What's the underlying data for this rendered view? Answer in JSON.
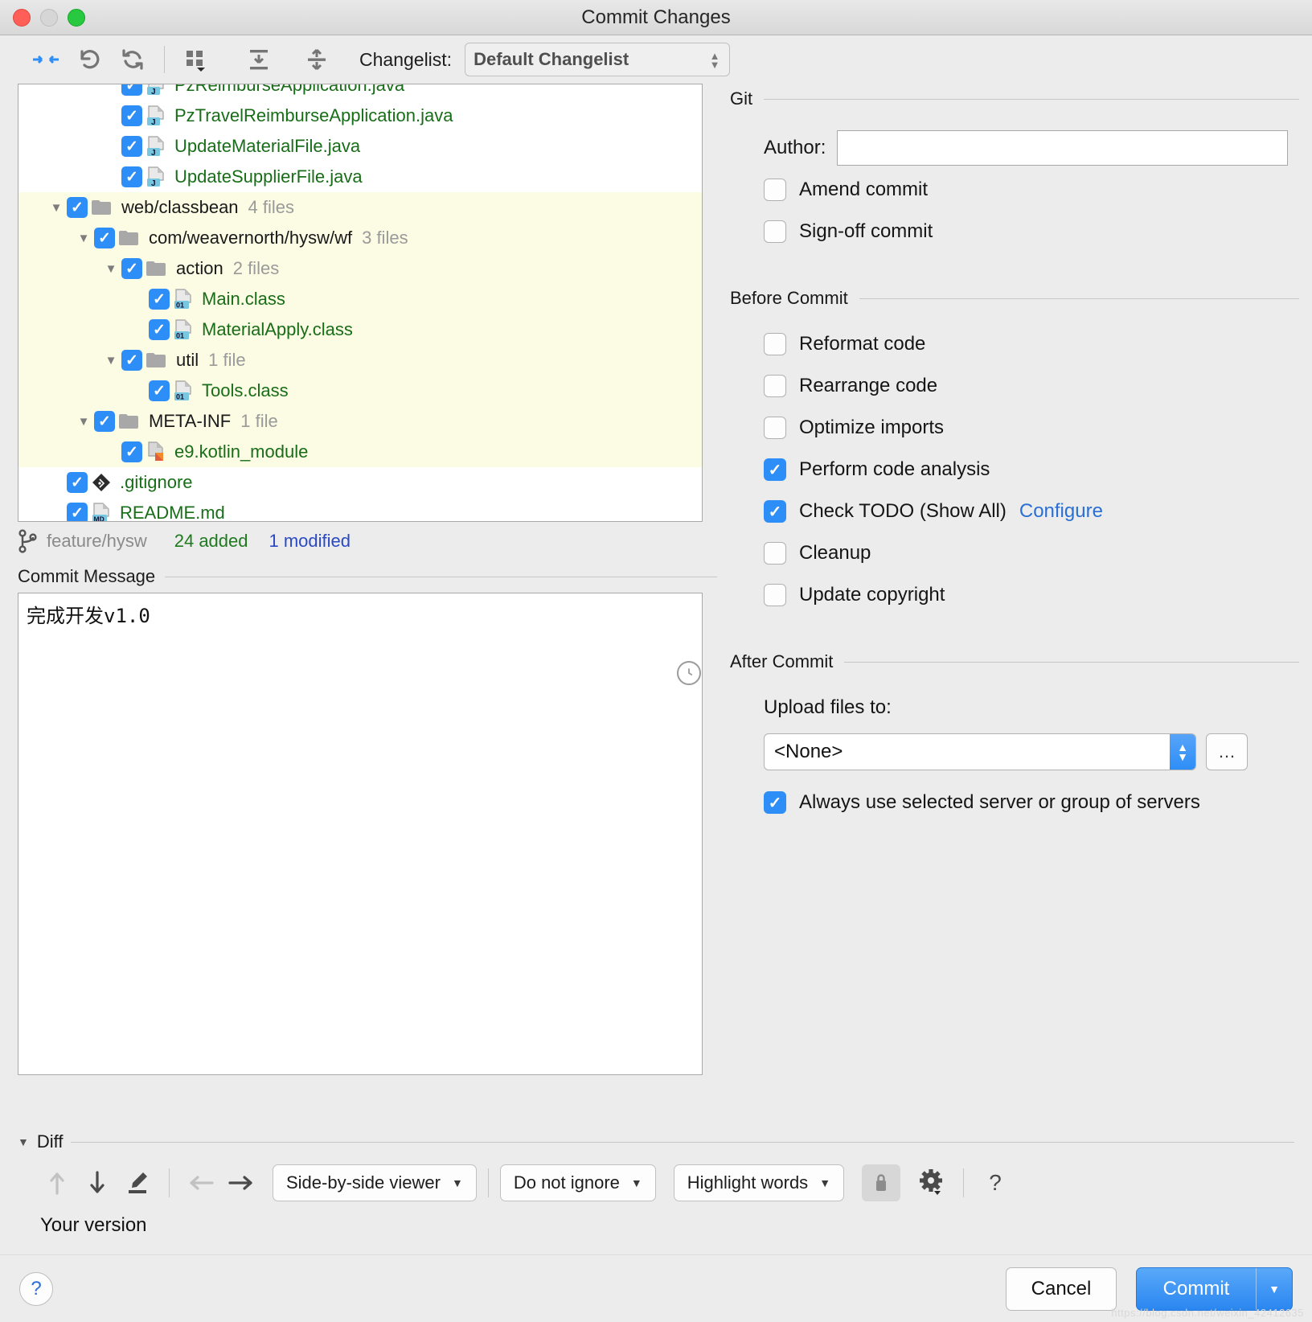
{
  "window": {
    "title": "Commit Changes"
  },
  "toolbar": {
    "icons": [
      "collapse-arrows-icon",
      "revert-icon",
      "refresh-icon",
      "group-by-icon",
      "expand-all-icon",
      "collapse-all-icon"
    ],
    "changelist_label": "Changelist:",
    "changelist_value": "Default Changelist"
  },
  "tree": {
    "rows": [
      {
        "indent": 3,
        "arrow": "",
        "checked": true,
        "icon": "java-file-icon",
        "name": "PzReimburseApplication.java",
        "count": "",
        "type": "file",
        "highlight": false,
        "clipped": true
      },
      {
        "indent": 3,
        "arrow": "",
        "checked": true,
        "icon": "java-file-icon",
        "name": "PzTravelReimburseApplication.java",
        "count": "",
        "type": "file",
        "highlight": false
      },
      {
        "indent": 3,
        "arrow": "",
        "checked": true,
        "icon": "java-file-icon",
        "name": "UpdateMaterialFile.java",
        "count": "",
        "type": "file",
        "highlight": false
      },
      {
        "indent": 3,
        "arrow": "",
        "checked": true,
        "icon": "java-file-icon",
        "name": "UpdateSupplierFile.java",
        "count": "",
        "type": "file",
        "highlight": false
      },
      {
        "indent": 1,
        "arrow": "down",
        "checked": true,
        "icon": "folder-icon",
        "name": "web/classbean",
        "count": "4 files",
        "type": "dir",
        "highlight": true
      },
      {
        "indent": 2,
        "arrow": "down",
        "checked": true,
        "icon": "folder-icon",
        "name": "com/weavernorth/hysw/wf",
        "count": "3 files",
        "type": "dir",
        "highlight": true
      },
      {
        "indent": 3,
        "arrow": "down",
        "checked": true,
        "icon": "folder-icon",
        "name": "action",
        "count": "2 files",
        "type": "dir",
        "highlight": true
      },
      {
        "indent": 4,
        "arrow": "",
        "checked": true,
        "icon": "class-file-icon",
        "name": "Main.class",
        "count": "",
        "type": "file",
        "highlight": true
      },
      {
        "indent": 4,
        "arrow": "",
        "checked": true,
        "icon": "class-file-icon",
        "name": "MaterialApply.class",
        "count": "",
        "type": "file",
        "highlight": true
      },
      {
        "indent": 3,
        "arrow": "down",
        "checked": true,
        "icon": "folder-icon",
        "name": "util",
        "count": "1 file",
        "type": "dir",
        "highlight": true
      },
      {
        "indent": 4,
        "arrow": "",
        "checked": true,
        "icon": "class-file-icon",
        "name": "Tools.class",
        "count": "",
        "type": "file",
        "highlight": true
      },
      {
        "indent": 2,
        "arrow": "down",
        "checked": true,
        "icon": "folder-icon",
        "name": "META-INF",
        "count": "1 file",
        "type": "dir",
        "highlight": true
      },
      {
        "indent": 3,
        "arrow": "",
        "checked": true,
        "icon": "kotlin-file-icon",
        "name": "e9.kotlin_module",
        "count": "",
        "type": "file",
        "highlight": true
      },
      {
        "indent": 1,
        "arrow": "",
        "checked": true,
        "icon": "git-file-icon",
        "name": ".gitignore",
        "count": "",
        "type": "file",
        "highlight": false
      },
      {
        "indent": 1,
        "arrow": "",
        "checked": true,
        "icon": "markdown-file-icon",
        "name": "README.md",
        "count": "",
        "type": "file",
        "highlight": false,
        "clippedBottom": true
      }
    ]
  },
  "status": {
    "branch_icon": "branch-icon",
    "branch": "feature/hysw",
    "added": "24 added",
    "modified": "1 modified"
  },
  "commit_message": {
    "label": "Commit Message",
    "history_icon": "clock-icon",
    "value": "完成开发v1.0"
  },
  "git": {
    "group_label": "Git",
    "author_label": "Author:",
    "author_value": "",
    "checkboxes": [
      {
        "label": "Amend commit",
        "checked": false
      },
      {
        "label": "Sign-off commit",
        "checked": false
      }
    ]
  },
  "before_commit": {
    "group_label": "Before Commit",
    "checkboxes": [
      {
        "label": "Reformat code",
        "checked": false,
        "link": ""
      },
      {
        "label": "Rearrange code",
        "checked": false,
        "link": ""
      },
      {
        "label": "Optimize imports",
        "checked": false,
        "link": ""
      },
      {
        "label": "Perform code analysis",
        "checked": true,
        "link": ""
      },
      {
        "label": "Check TODO (Show All)",
        "checked": true,
        "link": "Configure"
      },
      {
        "label": "Cleanup",
        "checked": false,
        "link": ""
      },
      {
        "label": "Update copyright",
        "checked": false,
        "link": ""
      }
    ]
  },
  "after_commit": {
    "group_label": "After Commit",
    "upload_label": "Upload files to:",
    "upload_value": "<None>",
    "browse_label": "…",
    "always_use": {
      "label": "Always use selected server or group of servers",
      "checked": true
    }
  },
  "diff": {
    "section_label": "Diff",
    "icons": [
      "prev-difference-icon",
      "next-difference-icon",
      "edit-icon",
      "apply-left-icon",
      "apply-right-icon"
    ],
    "viewer_mode": "Side-by-side viewer",
    "ignore_mode": "Do not ignore",
    "highlight_mode": "Highlight words",
    "lock_icon": "lock-icon",
    "settings_icon": "gear-icon",
    "help_icon": "question-mark-icon",
    "your_version_label": "Your version"
  },
  "footer": {
    "help_label": "?",
    "cancel_label": "Cancel",
    "commit_label": "Commit",
    "commit_dropdown_icon": "chevron-down-icon",
    "watermark": "https://blog.csdn.net/weixin_42412635"
  },
  "colors": {
    "accent": "#2e8ef7",
    "added_green": "#186d18",
    "modified_blue": "#2a49c4",
    "highlight_row": "#fcfbe3",
    "link": "#2a6fd4"
  }
}
